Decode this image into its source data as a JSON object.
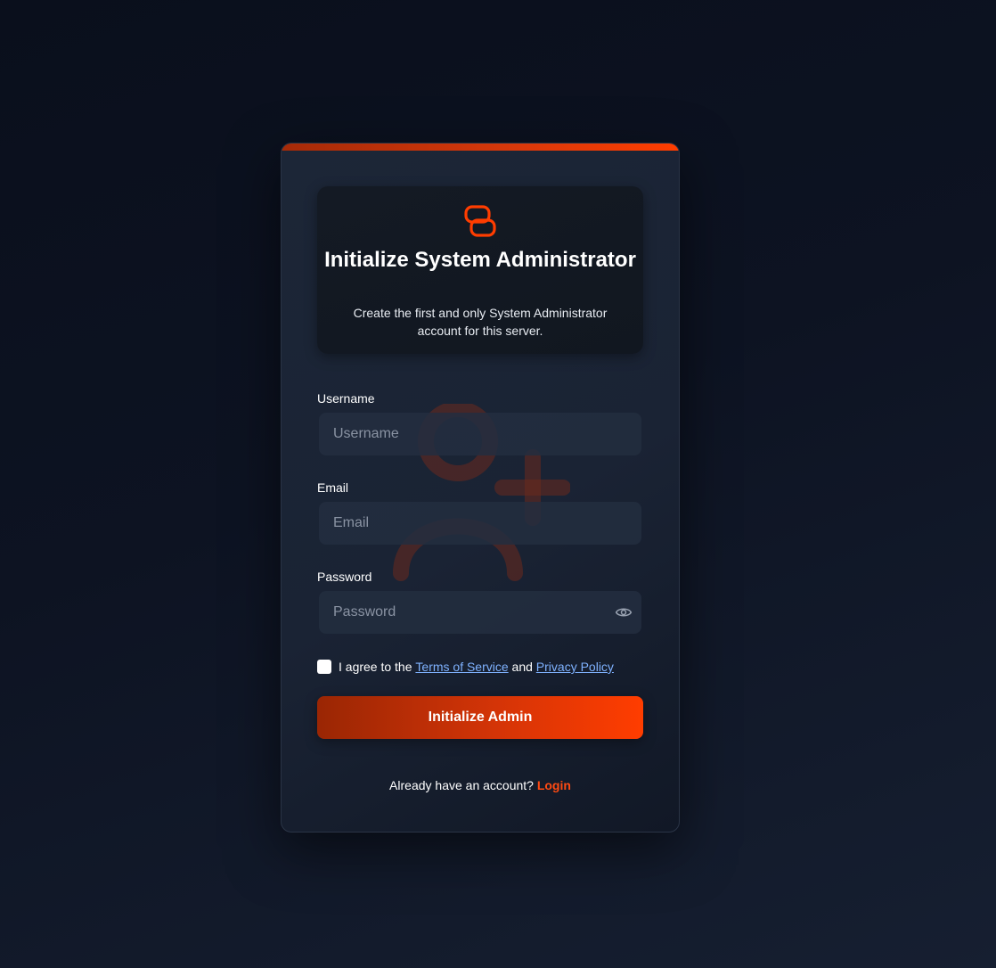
{
  "brand": {
    "logo_icon": "brand-logo-icon",
    "accent_color": "#ff3d00"
  },
  "header": {
    "title": "Initialize System Administrator",
    "subtitle": "Create the first and only System Administrator account for this server."
  },
  "form": {
    "username": {
      "label": "Username",
      "placeholder": "Username",
      "value": ""
    },
    "email": {
      "label": "Email",
      "placeholder": "Email",
      "value": ""
    },
    "password": {
      "label": "Password",
      "placeholder": "Password",
      "value": "",
      "toggle_icon": "eye-icon"
    },
    "agree": {
      "checked": false,
      "prefix": "I agree to the ",
      "terms_link": "Terms of Service",
      "middle": " and ",
      "privacy_link": "Privacy Policy"
    },
    "submit_label": "Initialize Admin"
  },
  "footer": {
    "prompt": "Already have an account? ",
    "login_link": "Login"
  },
  "decor": {
    "background_icon": "user-add-icon"
  }
}
